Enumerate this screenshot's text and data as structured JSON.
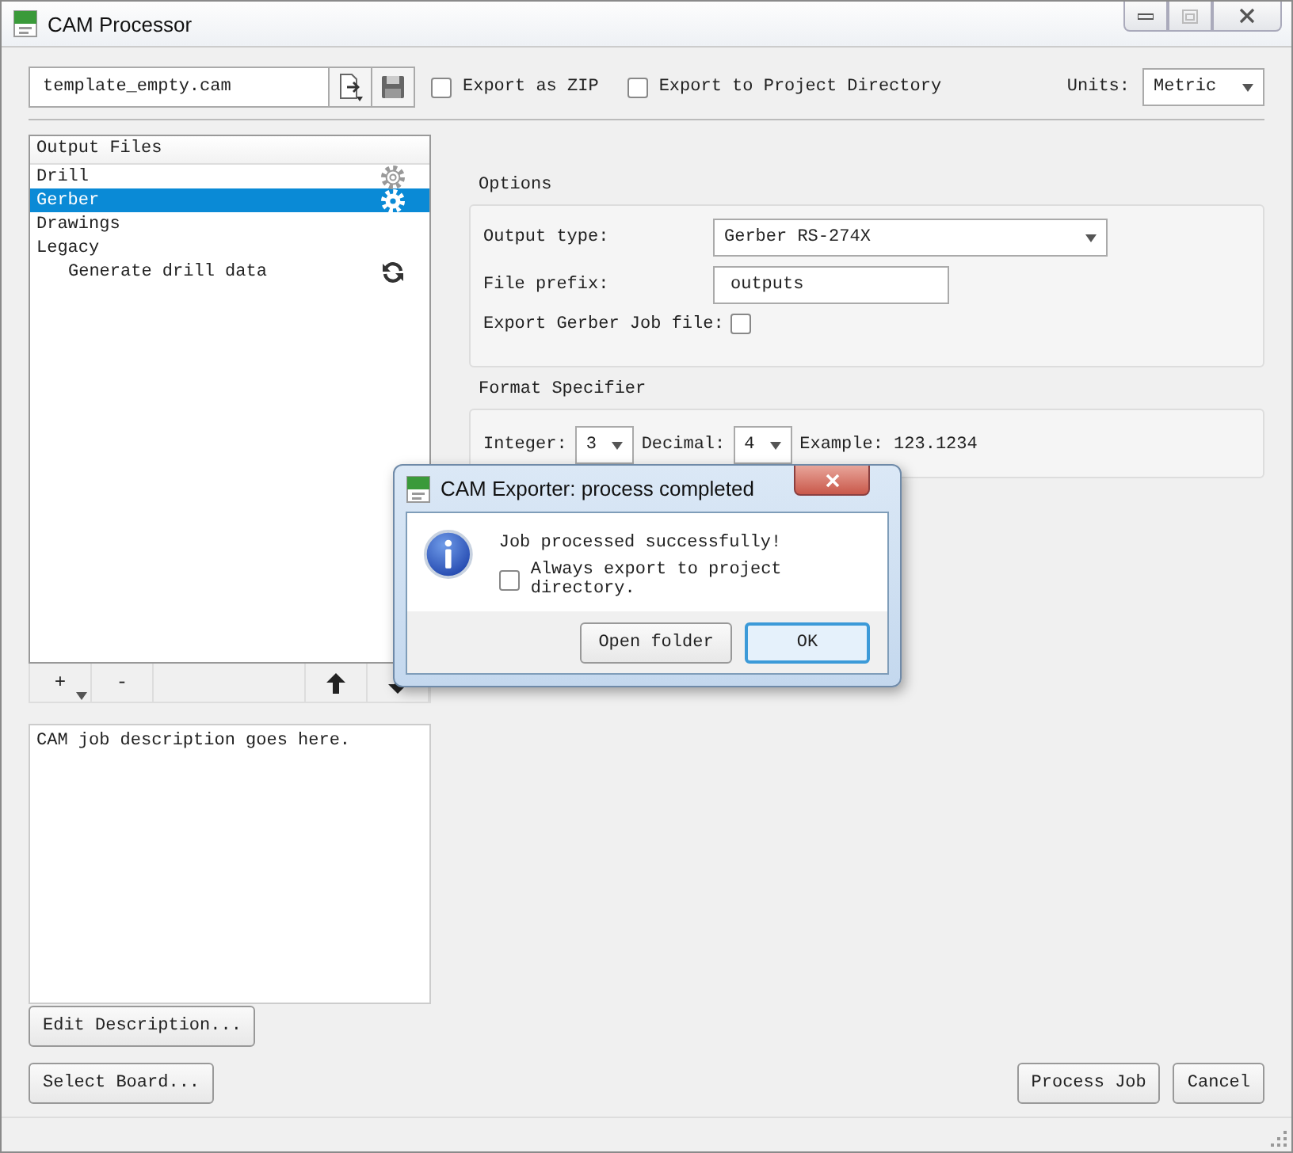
{
  "window": {
    "title": "CAM Processor"
  },
  "toolbar": {
    "job_file": "template_empty.cam",
    "export_zip": {
      "label": "Export as ZIP",
      "checked": false
    },
    "export_project": {
      "label": "Export to Project Directory",
      "checked": false
    },
    "units_label": "Units:",
    "units": "Metric"
  },
  "output_files": {
    "header": "Output Files",
    "items": [
      {
        "label": "Drill",
        "kind": "output",
        "selected": false
      },
      {
        "label": "Gerber",
        "kind": "output",
        "selected": true
      },
      {
        "label": "Drawings",
        "kind": "folder",
        "selected": false
      },
      {
        "label": "Legacy",
        "kind": "folder",
        "selected": false,
        "children": [
          {
            "label": "Generate drill data",
            "kind": "action",
            "selected": false
          }
        ]
      }
    ],
    "buttons": [
      "+",
      "-"
    ]
  },
  "description": "CAM job description goes here.",
  "left_buttons": [
    "Edit Description...",
    "Select Board..."
  ],
  "options": {
    "title": "Options",
    "output_type_label": "Output type:",
    "output_type": "Gerber RS-274X",
    "file_prefix_label": "File prefix:",
    "file_prefix": "outputs",
    "job_file_label": "Export Gerber Job file:",
    "job_file_checked": false
  },
  "format": {
    "title": "Format Specifier",
    "integer_label": "Integer:",
    "integer": "3",
    "decimal_label": "Decimal:",
    "decimal": "4",
    "example": "Example: 123.1234"
  },
  "actions": [
    "Process Job",
    "Cancel"
  ],
  "dialog": {
    "title": "CAM Exporter: process completed",
    "message": "Job processed successfully!",
    "checkbox": {
      "label": "Always export to project directory.",
      "checked": false
    },
    "buttons": [
      {
        "label": "Open folder",
        "focused": false
      },
      {
        "label": "OK",
        "focused": true
      }
    ]
  }
}
